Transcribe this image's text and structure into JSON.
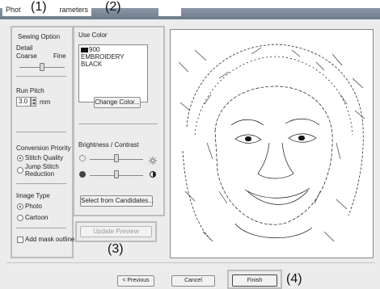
{
  "window": {
    "title_left": "Phot",
    "title_right": "rameters"
  },
  "callouts": {
    "c1": "(1)",
    "c2": "(2)",
    "c3": "(3)",
    "c4": "(4)"
  },
  "sewing": {
    "section_label": "Sewing Option",
    "detail_label": "Detail",
    "coarse_label": "Coarse",
    "fine_label": "Fine",
    "run_pitch_label": "Run Pitch",
    "run_pitch_value": "3.0",
    "run_pitch_unit": "mm",
    "conversion_priority_label": "Conversion Priority",
    "stitch_quality_label": "Stitch Quality",
    "jump_stitch_label_1": "Jump Stitch",
    "jump_stitch_label_2": "Reduction",
    "image_type_label": "Image Type",
    "photo_label": "Photo",
    "cartoon_label": "Cartoon",
    "add_mask_label": "Add mask outline"
  },
  "color": {
    "section_label": "Use Color",
    "list": [
      "900",
      "EMBROIDERY",
      "BLACK"
    ],
    "change_color_label": "Change Color...",
    "brightness_label": "Brightness / Contrast",
    "select_candidates_label": "Select from Candidates..."
  },
  "preview": {
    "update_preview_label": "Update Preview"
  },
  "footer": {
    "previous_label": "< Previous",
    "cancel_label": "Cancel",
    "finish_label": "Finish"
  },
  "colors": {
    "accent_highlight": "#bdbdbd",
    "swatch": "#111111"
  }
}
